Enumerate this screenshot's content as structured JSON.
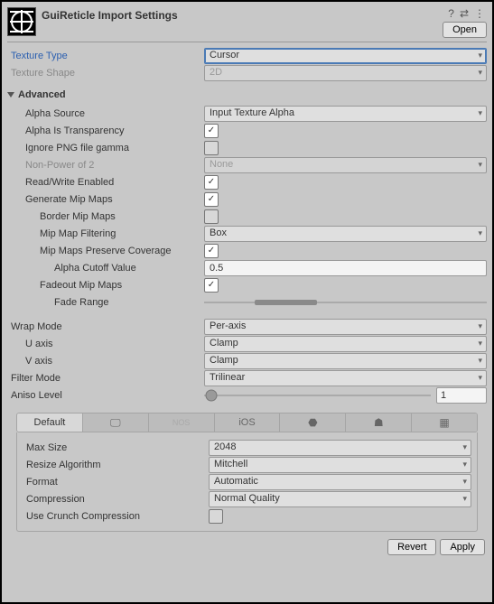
{
  "header": {
    "title": "GuiReticle Import Settings",
    "open": "Open",
    "help": "?",
    "preset": "⇄",
    "menu": "⋮"
  },
  "basic": {
    "texture_type_label": "Texture Type",
    "texture_type": "Cursor",
    "texture_shape_label": "Texture Shape",
    "texture_shape": "2D"
  },
  "adv": {
    "header": "Advanced",
    "alpha_source_label": "Alpha Source",
    "alpha_source": "Input Texture Alpha",
    "alpha_is_transparency_label": "Alpha Is Transparency",
    "alpha_is_transparency": true,
    "ignore_png_gamma_label": "Ignore PNG file gamma",
    "ignore_png_gamma": false,
    "npo2_label": "Non-Power of 2",
    "npo2": "None",
    "rw_label": "Read/Write Enabled",
    "rw": true,
    "gen_mip_label": "Generate Mip Maps",
    "gen_mip": true,
    "border_mip_label": "Border Mip Maps",
    "border_mip": false,
    "mip_filter_label": "Mip Map Filtering",
    "mip_filter": "Box",
    "preserve_cov_label": "Mip Maps Preserve Coverage",
    "preserve_cov": true,
    "alpha_cutoff_label": "Alpha Cutoff Value",
    "alpha_cutoff": "0.5",
    "fadeout_label": "Fadeout Mip Maps",
    "fadeout": true,
    "fade_range_label": "Fade Range",
    "fade_start_pct": 18,
    "fade_end_pct": 40
  },
  "tex": {
    "wrap_label": "Wrap Mode",
    "wrap": "Per-axis",
    "u_label": "U axis",
    "u": "Clamp",
    "v_label": "V axis",
    "v": "Clamp",
    "filter_label": "Filter Mode",
    "filter": "Trilinear",
    "aniso_label": "Aniso Level",
    "aniso": "1",
    "aniso_pct": 3
  },
  "tabs": {
    "default": "Default",
    "pc": "🖵",
    "nos": "NOS",
    "ios": "iOS",
    "ps": "⬣",
    "android": "☗",
    "w": "▦"
  },
  "plat": {
    "max_size_label": "Max Size",
    "max_size": "2048",
    "resize_label": "Resize Algorithm",
    "resize": "Mitchell",
    "format_label": "Format",
    "format": "Automatic",
    "compression_label": "Compression",
    "compression": "Normal Quality",
    "crunch_label": "Use Crunch Compression",
    "crunch": false
  },
  "footer": {
    "revert": "Revert",
    "apply": "Apply"
  }
}
